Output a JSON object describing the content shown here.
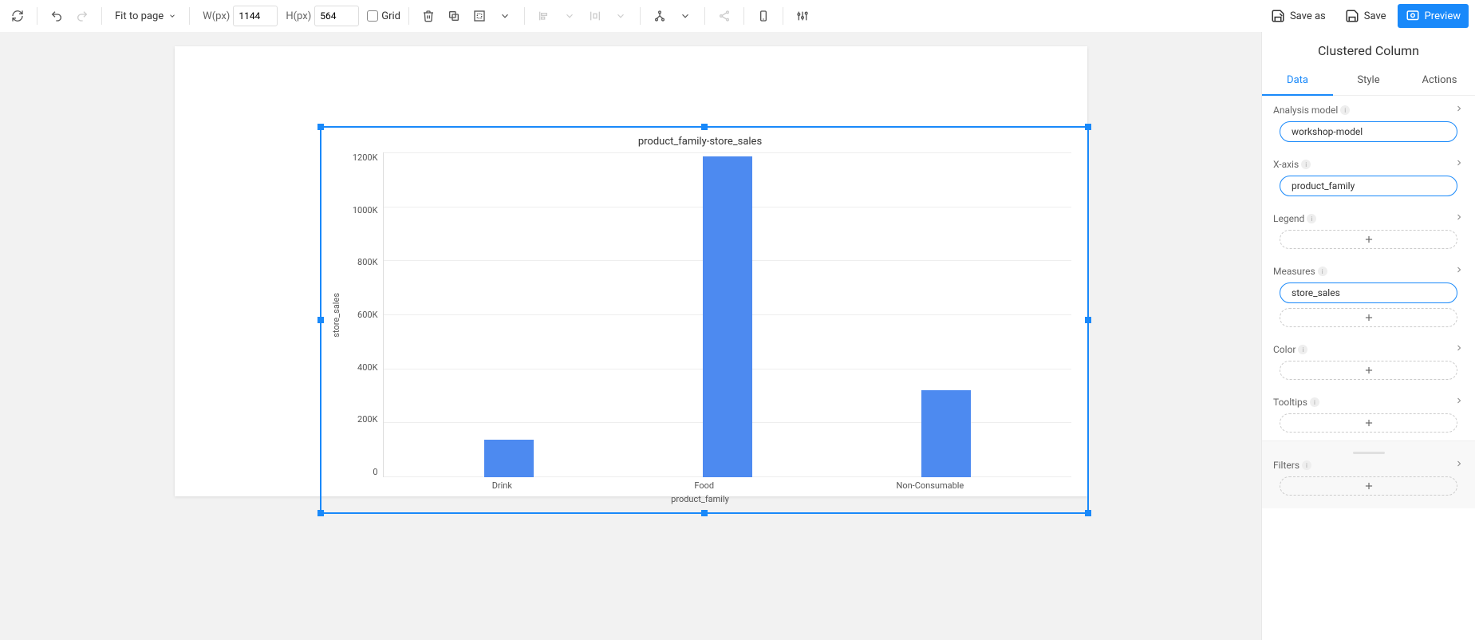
{
  "toolbar": {
    "zoom": "Fit to page",
    "w_label": "W(px)",
    "w_value": "1144",
    "h_label": "H(px)",
    "h_value": "564",
    "grid_label": "Grid",
    "save_as": "Save as",
    "save": "Save",
    "preview": "Preview"
  },
  "panel": {
    "title": "Clustered Column",
    "tabs": {
      "data": "Data",
      "style": "Style",
      "actions": "Actions"
    },
    "sections": {
      "analysis_model": {
        "label": "Analysis model",
        "value": "workshop-model"
      },
      "x_axis": {
        "label": "X-axis",
        "value": "product_family"
      },
      "legend": {
        "label": "Legend"
      },
      "measures": {
        "label": "Measures",
        "value": "store_sales"
      },
      "color": {
        "label": "Color"
      },
      "tooltips": {
        "label": "Tooltips"
      },
      "filters": {
        "label": "Filters"
      }
    }
  },
  "chart_data": {
    "type": "bar",
    "title": "product_family-store_sales",
    "xlabel": "product_family",
    "ylabel": "store_sales",
    "categories": [
      "Drink",
      "Food",
      "Non-Consumable"
    ],
    "values": [
      140000,
      1185000,
      320000
    ],
    "ylim": [
      0,
      1200000
    ],
    "y_ticks": [
      "1200K",
      "1000K",
      "800K",
      "600K",
      "400K",
      "200K",
      "0"
    ]
  }
}
